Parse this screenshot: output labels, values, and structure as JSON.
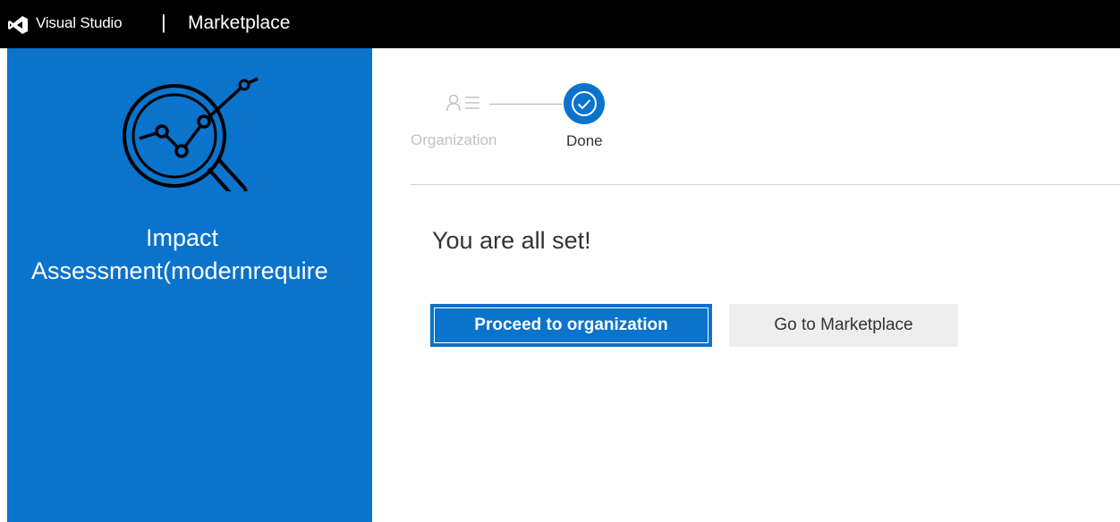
{
  "header": {
    "product_name": "Visual Studio",
    "separator": "|",
    "section_title": "Marketplace",
    "logo_icon": "visual-studio-logo-icon",
    "background_color": "#000000"
  },
  "extension_panel": {
    "name_line1": "Impact",
    "name_line2": "Assessment(modernrequire",
    "icon": "magnifier-line-chart-icon",
    "background_color": "#0a73cc"
  },
  "stepper": {
    "steps": [
      {
        "label": "Organization",
        "icon": "user-list-icon",
        "state": "completed"
      },
      {
        "label": "Done",
        "icon": "check-circle-icon",
        "state": "current"
      }
    ],
    "accent_color": "#0a73cc"
  },
  "main": {
    "headline": "You are all set!",
    "primary_button": "Proceed to organization",
    "secondary_button": "Go to Marketplace"
  }
}
